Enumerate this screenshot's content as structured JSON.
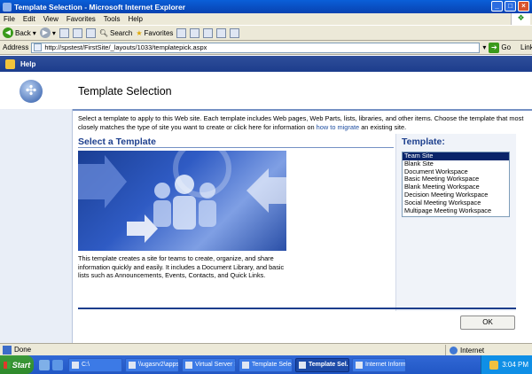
{
  "window": {
    "title": "Template Selection - Microsoft Internet Explorer"
  },
  "menu": [
    "File",
    "Edit",
    "View",
    "Favorites",
    "Tools",
    "Help"
  ],
  "toolbar": {
    "back": "Back",
    "search": "Search",
    "favorites": "Favorites"
  },
  "address": {
    "label": "Address",
    "url": "http://spstest/FirstSite/_layouts/1033/templatepick.aspx",
    "go": "Go",
    "links": "Links"
  },
  "helpbar": {
    "label": "Help"
  },
  "page": {
    "title": "Template Selection",
    "description_before": "Select a template to apply to this Web site. Each template includes Web pages, Web Parts, lists, libraries, and other items. Choose the template that most closely matches the type of site you want to create or click here for information on ",
    "description_link": "how to migrate",
    "description_after": " an existing site.",
    "select_heading": "Select a Template",
    "template_heading": "Template:",
    "templates": [
      "Team Site",
      "Blank Site",
      "Document Workspace",
      "Basic Meeting Workspace",
      "Blank Meeting Workspace",
      "Decision Meeting Workspace",
      "Social Meeting Workspace",
      "Multipage Meeting Workspace"
    ],
    "selected_index": 0,
    "template_description": "This template creates a site for teams to create, organize, and share information quickly and easily. It includes a Document Library, and basic lists such as Announcements, Events, Contacts, and Quick Links.",
    "ok": "OK"
  },
  "status": {
    "text": "Done",
    "zone": "Internet"
  },
  "taskbar": {
    "start": "Start",
    "tasks": [
      "C:\\",
      "\\\\ugasrv2\\apps...",
      "Virtual Server S...",
      "Template Selec...",
      "Template Sel...",
      "Internet Inform..."
    ],
    "active_index": 4,
    "clock": "3:04 PM"
  },
  "colors": {
    "title_blue": "#0a5fd8",
    "help_bar": "#1c3d8c",
    "heading": "#1d3f8d",
    "selection": "#0a246a"
  }
}
